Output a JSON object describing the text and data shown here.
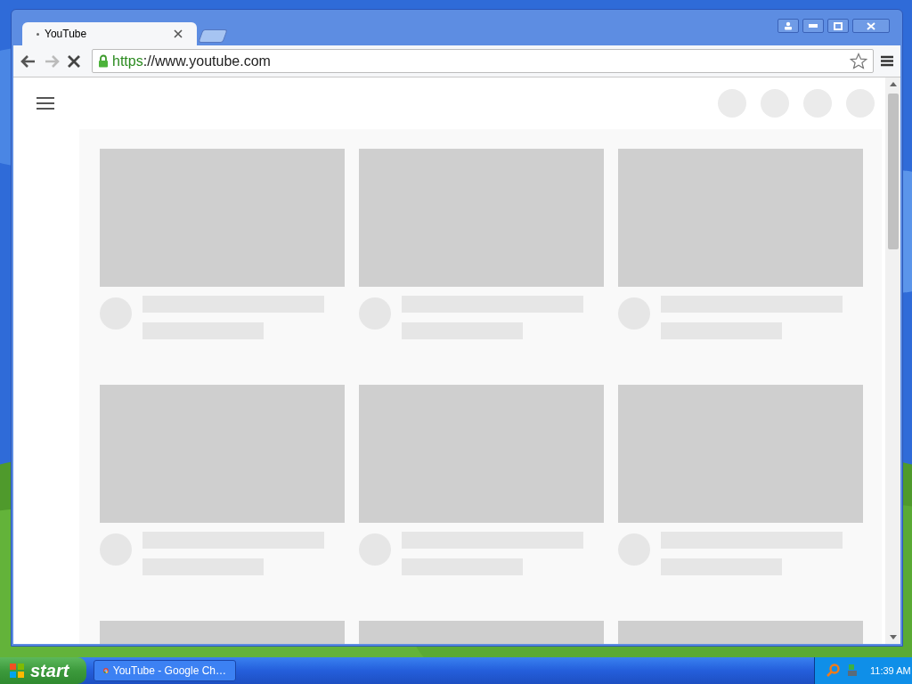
{
  "browser": {
    "tabs": [
      {
        "title": "YouTube",
        "selected": true
      }
    ],
    "loading": true,
    "forward_disabled": true,
    "url": {
      "scheme": "https",
      "rest": "://www.youtube.com"
    },
    "secure": true
  },
  "page": {
    "header_buttons": [
      {
        "kind": "skeleton"
      },
      {
        "kind": "skeleton"
      },
      {
        "kind": "skeleton"
      },
      {
        "kind": "skeleton"
      }
    ],
    "feed_cards": [
      {
        "kind": "skeleton"
      },
      {
        "kind": "skeleton"
      },
      {
        "kind": "skeleton"
      },
      {
        "kind": "skeleton"
      },
      {
        "kind": "skeleton"
      },
      {
        "kind": "skeleton"
      },
      {
        "kind": "partial"
      },
      {
        "kind": "partial"
      },
      {
        "kind": "partial"
      }
    ]
  },
  "taskbar": {
    "start": "start",
    "tasks": [
      {
        "label": "YouTube - Google Ch…",
        "selected": false
      }
    ],
    "clock": "11:39 AM"
  }
}
